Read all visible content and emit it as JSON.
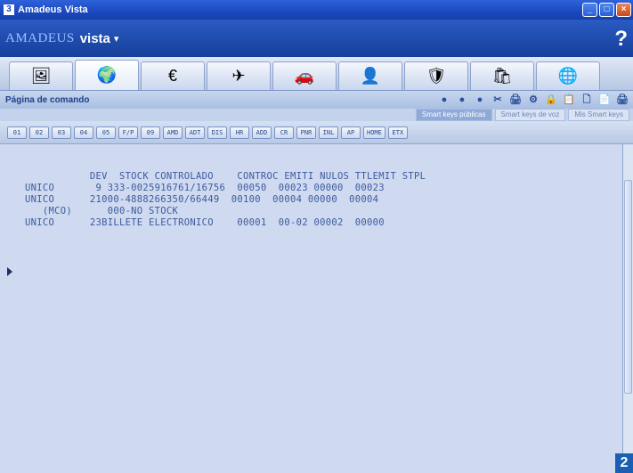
{
  "window": {
    "title": "Amadeus Vista",
    "icon_glyph": "3",
    "minimize_glyph": "_",
    "maximize_glyph": "□",
    "close_glyph": "×"
  },
  "brand": {
    "name": "AMADEUS",
    "product": "vista",
    "caret": "▾",
    "help": "?"
  },
  "tabs": [
    {
      "icon": "🖼"
    },
    {
      "icon": "🌍"
    },
    {
      "icon": "€"
    },
    {
      "icon": "✈"
    },
    {
      "icon": "🚗"
    },
    {
      "icon": "👤"
    },
    {
      "icon": "🛡"
    },
    {
      "icon": "🛍"
    },
    {
      "icon": "🌐"
    }
  ],
  "pagebar": {
    "title": "Página de comando",
    "tools": [
      "●",
      "●",
      "●",
      "✂",
      "🖨",
      "⚙",
      "🔒",
      "📋",
      "🗋",
      "📄",
      "🖨"
    ]
  },
  "subtabs": [
    {
      "label": "Smart keys públicas",
      "active": true
    },
    {
      "label": "Smart keys de voz",
      "active": false
    },
    {
      "label": "Mis Smart keys",
      "active": false
    }
  ],
  "keys": [
    "01",
    "02",
    "03",
    "04",
    "05",
    "F/P",
    "09",
    "AMD",
    "ADT",
    "DIS",
    "HR",
    "ADD",
    "CR",
    "PNR",
    "INL",
    "AP",
    "HOME",
    "ETX"
  ],
  "terminal": {
    "output": "           DEV  STOCK CONTROLADO    CONTROC EMITI NULOS TTLEMIT STPL\nUNICO       9 333-0025916761/16756  00050  00023 00000  00023\nUNICO      21000-4888266350/66449  00100  00004 00000  00004\n   (MCO)      000-NO STOCK\nUNICO      23BILLETE ELECTRONICO    00001  00-02 00002  00000"
  },
  "badge": "2"
}
